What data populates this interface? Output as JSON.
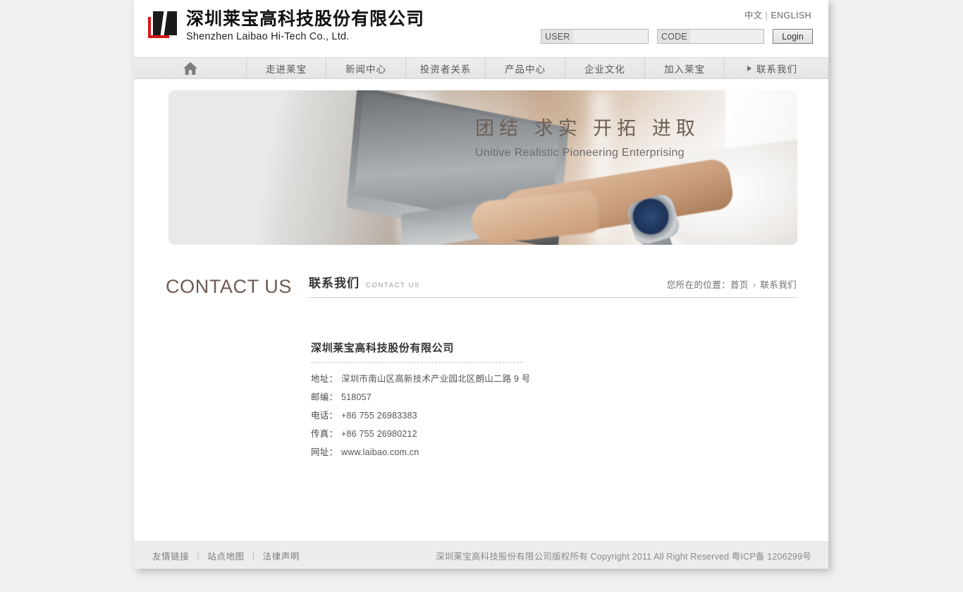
{
  "header": {
    "logo": {
      "cn": "深圳莱宝高科技股份有限公司",
      "en": "Shenzhen Laibao Hi-Tech Co., Ltd.",
      "icon": "laibao-logo-mark"
    },
    "lang": {
      "cn_label": "中文",
      "separator": "|",
      "en_label": "ENGLISH"
    },
    "login": {
      "user_label": "USER",
      "user_value": "",
      "user_placeholder": "",
      "code_label": "CODE",
      "code_value": "",
      "code_placeholder": "",
      "button_label": "Login"
    }
  },
  "nav": {
    "home_icon": "home-icon",
    "active_marker_icon": "triangle-right-icon",
    "items": [
      {
        "label": "",
        "name": "home",
        "active": false
      },
      {
        "label": "走进莱宝",
        "name": "about",
        "active": false
      },
      {
        "label": "新闻中心",
        "name": "news",
        "active": false
      },
      {
        "label": "投资者关系",
        "name": "investor",
        "active": false
      },
      {
        "label": "产品中心",
        "name": "products",
        "active": false
      },
      {
        "label": "企业文化",
        "name": "culture",
        "active": false
      },
      {
        "label": "加入莱宝",
        "name": "join",
        "active": false
      },
      {
        "label": "联系我们",
        "name": "contact",
        "active": true
      }
    ]
  },
  "banner": {
    "slogan_cn": "团结 求实 开拓 进取",
    "slogan_en": "Unitive Realistic Pioneering Enterprising",
    "image_alt": "hands-typing-on-laptop-photo"
  },
  "content": {
    "page_title": "CONTACT US",
    "section_cn": "联系我们",
    "section_en": "CONTACT US",
    "breadcrumb": {
      "prefix": "您所在的位置：",
      "home": "首页",
      "chevron": "›",
      "current": "联系我们"
    },
    "company_name": "深圳莱宝高科技股份有限公司",
    "info": [
      {
        "key": "地址：",
        "value": "深圳市南山区高新技术产业园北区朗山二路 9 号"
      },
      {
        "key": "邮编：",
        "value": "518057"
      },
      {
        "key": "电话：",
        "value": "+86 755 26983383"
      },
      {
        "key": "传真：",
        "value": "+86 755 26980212"
      },
      {
        "key": "网址：",
        "value": "www.laibao.com.cn"
      }
    ]
  },
  "footer": {
    "links": [
      {
        "label": "友情链接"
      },
      {
        "label": "站点地图"
      },
      {
        "label": "法律声明"
      }
    ],
    "separator": "|",
    "copyright": "深圳莱宝高科技股份有限公司版权所有 Copyright 2011 All Right Reserved",
    "icp": "粤ICP备 1206299号"
  },
  "colors": {
    "page_bg": "#f0f0f0",
    "container_bg": "#ffffff",
    "nav_bg": "#e9e9e9",
    "accent_brown": "#6d5c52",
    "logo_red": "#d6161b",
    "footer_bg": "#ececec"
  }
}
